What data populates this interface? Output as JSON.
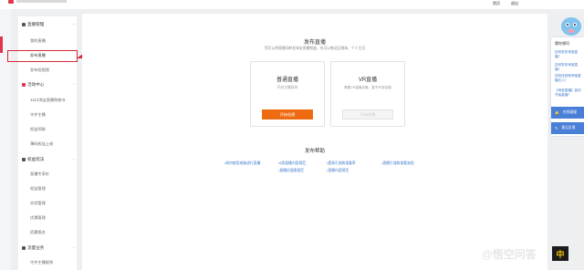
{
  "topbar": {
    "links": [
      "首页",
      "退出"
    ]
  },
  "sidebar": {
    "sections": [
      {
        "label": "直播管理",
        "items": [
          "我的直播",
          "发布直播",
          "发布短视频"
        ]
      },
      {
        "label": "活动中心",
        "items": [
          "1212淘宝直播购物节",
          "守护主播",
          "权益领取",
          "薄码权益上线"
        ]
      },
      {
        "label": "权益玩法",
        "items": [
          "直播专享价",
          "权益管理",
          "实验管理",
          "优惠管理",
          "招募报名"
        ]
      },
      {
        "label": "流量业务",
        "items": [
          "守护主播规则"
        ]
      }
    ]
  },
  "main": {
    "publish_title": "发布直播",
    "publish_subtitle": "您可以将直播间转发淘宝直播频道，也可以推送至微淘、个人主页",
    "cards": [
      {
        "title": "普通直播",
        "desc": "开启主播身份",
        "button": "开始创建"
      },
      {
        "title": "VR直播",
        "desc": "需要VR直播设备，暂不开放创建",
        "button": "开始创建"
      }
    ],
    "help_title": "发布帮助",
    "help_links": [
      "如何使用电脑进行直播",
      "5类直播内容规范",
      "提高引流和观看率",
      "直播引流和观看流程",
      "直播封面图规范",
      "直播内容规范"
    ]
  },
  "float_panel": {
    "title": "猜你想问",
    "links": [
      "如何发布淘宝直播？",
      "如何发布淘宝直播？",
      "如何找到和淘宝直播达人？",
      "【淘宝直播】如何开始直播？"
    ],
    "service_label": "在线客服",
    "feedback_label": "意见反馈"
  },
  "watermark": {
    "left": "中",
    "right": "@悟空问答"
  }
}
